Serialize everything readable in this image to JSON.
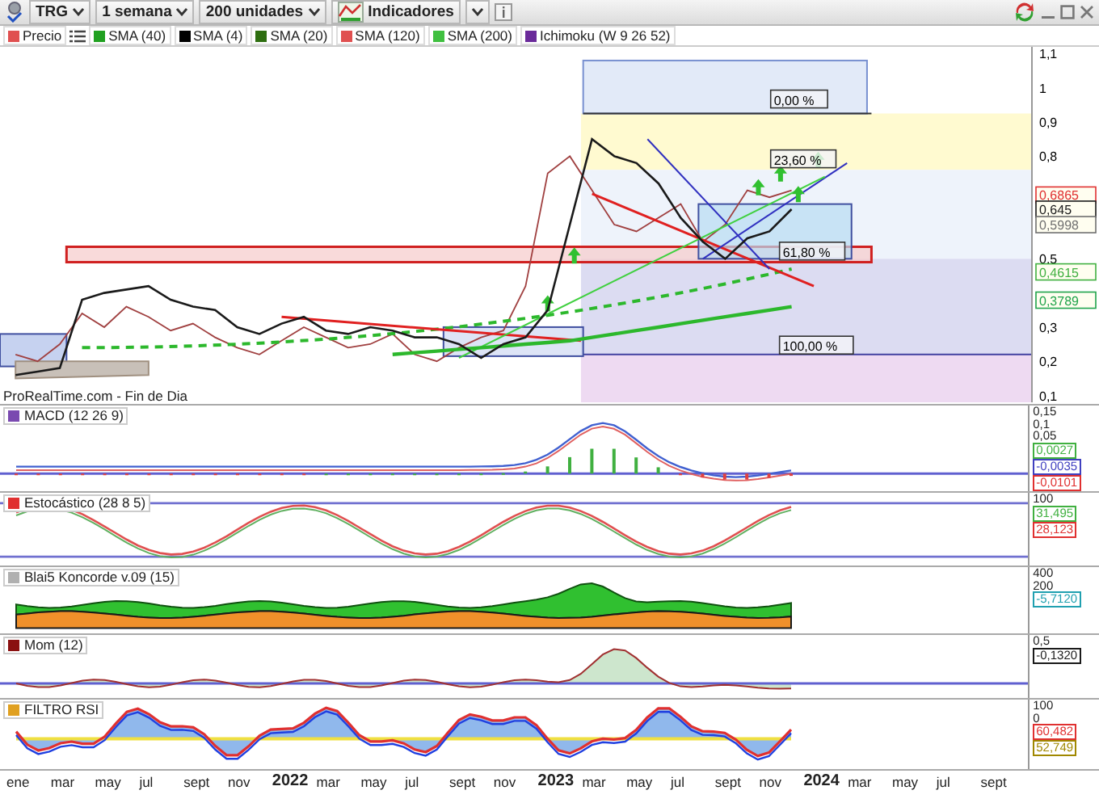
{
  "toolbar": {
    "symbol": "TRG",
    "period": "1 semana",
    "units": "200 unidades",
    "indicators_label": "Indicadores"
  },
  "legend": [
    {
      "label": "Precio",
      "color": "#e05050"
    },
    {
      "label": "SMA (40)",
      "color": "#20a020"
    },
    {
      "label": "SMA (4)",
      "color": "#000000"
    },
    {
      "label": "SMA (20)",
      "color": "#2e6e10"
    },
    {
      "label": "SMA (120)",
      "color": "#e05050"
    },
    {
      "label": "SMA (200)",
      "color": "#40c040"
    },
    {
      "label": "Ichimoku (W 9 26 52)",
      "color": "#6a2a9a"
    }
  ],
  "main_chart": {
    "source": "ProRealTime.com - Fin de Dia",
    "price_axis": [
      "1,1",
      "1",
      "0,9",
      "0,8",
      "0,5",
      "0,3",
      "0,2",
      "0,1"
    ],
    "fibonacci_labels": [
      "0,00 %",
      "23,60 %",
      "61,80 %",
      "100,00 %"
    ],
    "price_tags": [
      {
        "text": "0,6865",
        "color": "#e03030"
      },
      {
        "text": "0,645",
        "color": "#1a1a1a"
      },
      {
        "text": "0,5998",
        "color": "#707070"
      },
      {
        "text": "0,4615",
        "color": "#40b040"
      },
      {
        "text": "0,3789",
        "color": "#1fa34a"
      }
    ]
  },
  "panels": [
    {
      "kind": "macd",
      "title": "MACD (12 26 9)",
      "color": "#7a4ab0",
      "axis_labels": [
        "0,15",
        "0,1",
        "0,05"
      ],
      "value_tags": [
        {
          "text": "0,0027",
          "color": "#40b040"
        },
        {
          "text": "-0,0035",
          "color": "#4040c0"
        },
        {
          "text": "-0,0101",
          "color": "#e03030"
        }
      ]
    },
    {
      "kind": "stochastic",
      "title": "Estocástico (28 8 5)",
      "color": "#e03030",
      "axis_labels": [
        "100"
      ],
      "value_tags": [
        {
          "text": "31,495",
          "color": "#40b040"
        },
        {
          "text": "28,123",
          "color": "#e03030"
        }
      ]
    },
    {
      "kind": "koncorde",
      "title": "Blai5 Koncorde v.09 (15)",
      "color": "#b0b0b0",
      "axis_labels": [
        "400",
        "200"
      ],
      "value_tags": [
        {
          "text": "-5,7120",
          "color": "#20a0b0"
        }
      ]
    },
    {
      "kind": "momentum",
      "title": "Mom (12)",
      "color": "#8a1010",
      "axis_labels": [
        "0,5"
      ],
      "value_tags": [
        {
          "text": "-0,1320",
          "color": "#1a1a1a"
        }
      ]
    },
    {
      "kind": "rsi",
      "title": "FILTRO RSI",
      "color": "#e0a020",
      "axis_labels": [
        "100",
        "0"
      ],
      "value_tags": [
        {
          "text": "60,482",
          "color": "#e03030"
        },
        {
          "text": "52,749",
          "color": "#a08800"
        }
      ]
    }
  ],
  "date_axis": [
    {
      "label": "ene",
      "kind": "month"
    },
    {
      "label": "mar",
      "kind": "month"
    },
    {
      "label": "may",
      "kind": "month"
    },
    {
      "label": "jul",
      "kind": "month"
    },
    {
      "label": "sept",
      "kind": "month"
    },
    {
      "label": "nov",
      "kind": "month"
    },
    {
      "label": "2022",
      "kind": "year"
    },
    {
      "label": "mar",
      "kind": "month"
    },
    {
      "label": "may",
      "kind": "month"
    },
    {
      "label": "jul",
      "kind": "month"
    },
    {
      "label": "sept",
      "kind": "month"
    },
    {
      "label": "nov",
      "kind": "month"
    },
    {
      "label": "2023",
      "kind": "year"
    },
    {
      "label": "mar",
      "kind": "month"
    },
    {
      "label": "may",
      "kind": "month"
    },
    {
      "label": "jul",
      "kind": "month"
    },
    {
      "label": "sept",
      "kind": "month"
    },
    {
      "label": "nov",
      "kind": "month"
    },
    {
      "label": "2024",
      "kind": "year"
    },
    {
      "label": "mar",
      "kind": "month"
    },
    {
      "label": "may",
      "kind": "month"
    },
    {
      "label": "jul",
      "kind": "month"
    },
    {
      "label": "sept",
      "kind": "month"
    }
  ]
}
